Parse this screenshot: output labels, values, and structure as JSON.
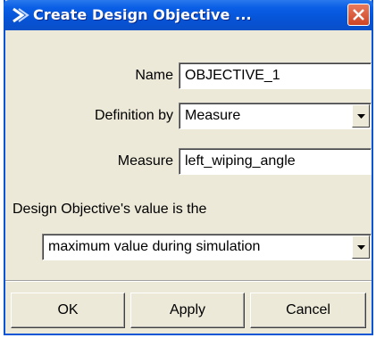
{
  "window": {
    "title": "Create Design Objective ...",
    "icon": "adams-chevron-icon",
    "close": "close-icon",
    "titlebar_color": "#0654d8",
    "close_color": "#d94f2d"
  },
  "form": {
    "name_label": "Name",
    "name_value": "OBJECTIVE_1",
    "definition_label": "Definition by",
    "definition_value": "Measure",
    "measure_label": "Measure",
    "measure_value": "left_wiping_angle",
    "section_label": "Design Objective's value is the",
    "value_type": "maximum value during simulation"
  },
  "buttons": {
    "ok": "OK",
    "apply": "Apply",
    "cancel": "Cancel"
  }
}
